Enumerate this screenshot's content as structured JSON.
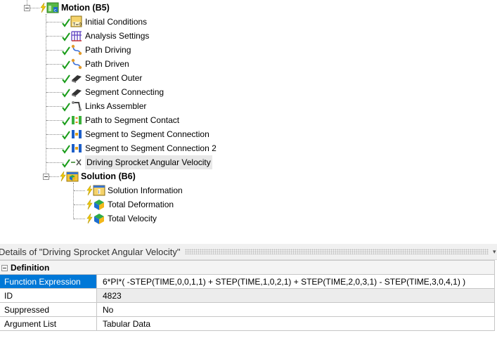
{
  "tree": {
    "motion": {
      "label": "Motion (B5)"
    },
    "children": [
      {
        "label": "Initial Conditions",
        "icon": "initial-conditions-icon"
      },
      {
        "label": "Analysis Settings",
        "icon": "analysis-settings-icon"
      },
      {
        "label": "Path Driving",
        "icon": "path-icon"
      },
      {
        "label": "Path Driven",
        "icon": "path-icon"
      },
      {
        "label": "Segment Outer",
        "icon": "segment-icon"
      },
      {
        "label": "Segment Connecting",
        "icon": "segment-icon"
      },
      {
        "label": "Links Assembler",
        "icon": "links-assembler-icon"
      },
      {
        "label": "Path to Segment Contact",
        "icon": "contact-icon"
      },
      {
        "label": "Segment to Segment Connection",
        "icon": "connection-icon"
      },
      {
        "label": "Segment to Segment Connection 2",
        "icon": "connection-icon"
      },
      {
        "label": "Driving Sprocket Angular Velocity",
        "icon": "joint-load-icon"
      }
    ],
    "solution": {
      "label": "Solution (B6)"
    },
    "solution_children": [
      {
        "label": "Solution Information",
        "icon": "solution-information-icon"
      },
      {
        "label": "Total Deformation",
        "icon": "result-cube-icon"
      },
      {
        "label": "Total Velocity",
        "icon": "result-cube-icon"
      }
    ]
  },
  "details": {
    "title": "Details of \"Driving Sprocket Angular Velocity\"",
    "category": "Definition",
    "rows": [
      {
        "key": "Function Expression",
        "value": "6*PI*( -STEP(TIME,0,0,1,1) + STEP(TIME,1,0,2,1) + STEP(TIME,2,0,3,1) - STEP(TIME,3,0,4,1) )"
      },
      {
        "key": "ID",
        "value": "4823"
      },
      {
        "key": "Suppressed",
        "value": "No"
      },
      {
        "key": "Argument List",
        "value": "Tabular Data"
      }
    ]
  },
  "colors": {
    "selection": "#0078d7",
    "check": "#1a9c1a",
    "bolt": "#e6c200"
  }
}
